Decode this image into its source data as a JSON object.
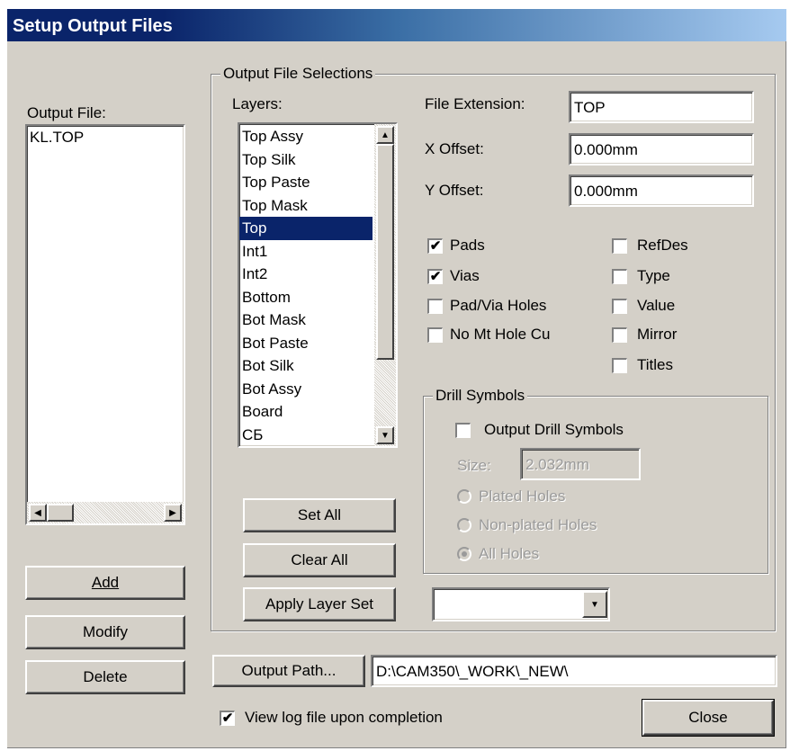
{
  "window": {
    "title": "Setup Output Files"
  },
  "output_file": {
    "label": "Output File:",
    "items": [
      "KL.TOP"
    ]
  },
  "buttons": {
    "add": "Add",
    "modify": "Modify",
    "delete": "Delete",
    "set_all": "Set All",
    "clear_all": "Clear All",
    "apply_layer_set": "Apply Layer Set",
    "output_path": "Output Path...",
    "close": "Close"
  },
  "selections_group": {
    "label": "Output File Selections"
  },
  "layers": {
    "label": "Layers:",
    "items": [
      "Top Assy",
      "Top Silk",
      "Top Paste",
      "Top Mask",
      "Top",
      "Int1",
      "Int2",
      "Bottom",
      "Bot Mask",
      "Bot Paste",
      "Bot Silk",
      "Bot Assy",
      "Board",
      "СБ"
    ],
    "selected": "Top"
  },
  "fields": {
    "file_extension": {
      "label": "File Extension:",
      "value": "TOP"
    },
    "x_offset": {
      "label": "X Offset:",
      "value": "0.000mm"
    },
    "y_offset": {
      "label": "Y Offset:",
      "value": "0.000mm"
    }
  },
  "checkboxes": {
    "pads": {
      "label": "Pads",
      "checked": true
    },
    "vias": {
      "label": "Vias",
      "checked": true
    },
    "pad_via_holes": {
      "label": "Pad/Via Holes",
      "checked": false
    },
    "no_mt_hole_cu": {
      "label": "No Mt Hole Cu",
      "checked": false
    },
    "refdes": {
      "label": "RefDes",
      "checked": false
    },
    "type": {
      "label": "Type",
      "checked": false
    },
    "value": {
      "label": "Value",
      "checked": false
    },
    "mirror": {
      "label": "Mirror",
      "checked": false
    },
    "titles": {
      "label": "Titles",
      "checked": false
    }
  },
  "drill_symbols": {
    "label": "Drill Symbols",
    "output_drill_symbols": {
      "label": "Output Drill Symbols",
      "checked": false
    },
    "size": {
      "label": "Size:",
      "value": "2.032mm"
    },
    "radios": [
      "Plated Holes",
      "Non-plated Holes",
      "All Holes"
    ],
    "selected": "All Holes"
  },
  "layer_set_select": {
    "value": ""
  },
  "output_path": {
    "value": "D:\\CAM350\\_WORK\\_NEW\\"
  },
  "view_log": {
    "label": "View log file upon completion",
    "checked": true
  },
  "icons": {
    "check": "✔",
    "arrow_up": "▲",
    "arrow_down": "▼",
    "arrow_left": "◀",
    "arrow_right": "▶"
  },
  "colors": {
    "title_gradient_start": "#0a246a",
    "title_gradient_end": "#a6caf0",
    "face": "#d4d0c8",
    "selection": "#0a246a"
  }
}
